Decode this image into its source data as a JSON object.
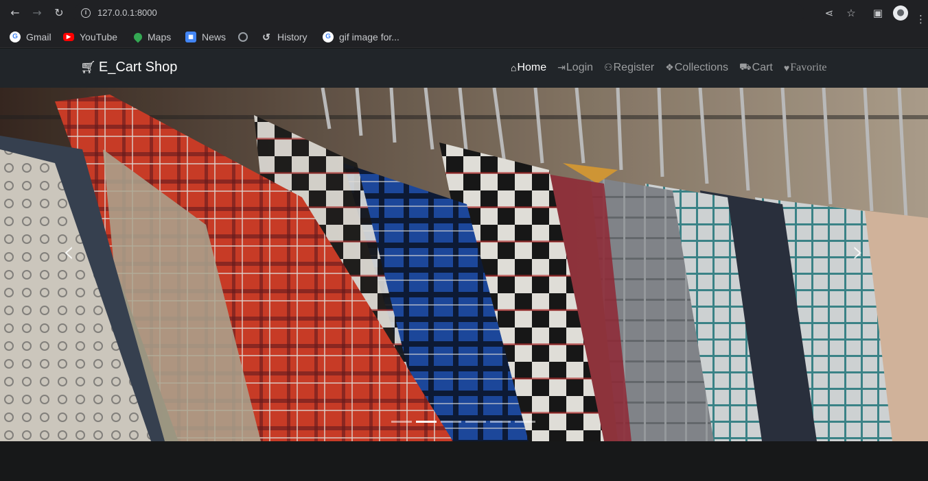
{
  "browser": {
    "url": "127.0.0.1:8000",
    "bookmarks": [
      {
        "label": "Gmail",
        "icon": "google-icon"
      },
      {
        "label": "YouTube",
        "icon": "youtube-icon"
      },
      {
        "label": "Maps",
        "icon": "maps-icon"
      },
      {
        "label": "News",
        "icon": "news-icon"
      },
      {
        "label": "",
        "icon": "globe-icon"
      },
      {
        "label": "History",
        "icon": "history-icon"
      },
      {
        "label": "gif image for...",
        "icon": "google-icon"
      }
    ]
  },
  "site": {
    "brand": "E_Cart Shop",
    "nav": [
      {
        "label": "Home",
        "icon": "home-icon",
        "active": true
      },
      {
        "label": "Login",
        "icon": "sign-in-icon",
        "active": false
      },
      {
        "label": "Register",
        "icon": "users-icon",
        "active": false
      },
      {
        "label": "Collections",
        "icon": "cubes-icon",
        "active": false
      },
      {
        "label": "Cart",
        "icon": "cart-icon",
        "active": false
      },
      {
        "label": "Favorite",
        "icon": "heart-icon",
        "active": false
      }
    ]
  },
  "carousel": {
    "prev_label": "‹",
    "next_label": "›",
    "slide_count": 6,
    "active_index": 1
  },
  "colors": {
    "navbar": "#212529",
    "browser": "#202124",
    "page": "#171819"
  }
}
